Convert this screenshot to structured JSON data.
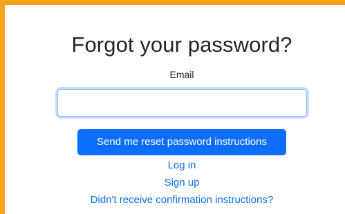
{
  "page": {
    "title": "Forgot your password?",
    "accent_color": "#f7a21b",
    "primary_color": "#0d6efd"
  },
  "form": {
    "email_label": "Email",
    "email_value": "",
    "submit_label": "Send me reset password instructions"
  },
  "links": {
    "login": "Log in",
    "signup": "Sign up",
    "confirmation": "Didn't receive confirmation instructions?"
  }
}
